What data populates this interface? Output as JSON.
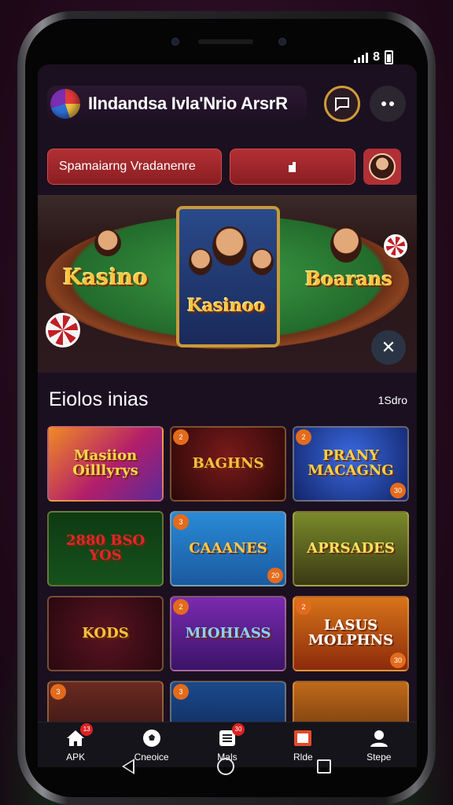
{
  "header": {
    "app_title": "Ilndandsa Ivla'Nrio ArsrR",
    "status_battery_label": "8"
  },
  "search": {
    "text": "Spamaiarng Vradanenre"
  },
  "banner": {
    "left_brand": "Kasino",
    "center_brand": "Kasinoo",
    "right_brand": "Boarans"
  },
  "section": {
    "title": "Eiolos inias",
    "link": "1Sdro"
  },
  "tiles": [
    {
      "title": "Masiion Oilllyrys",
      "bg": "linear-gradient(135deg,#f08a24,#b31e6a 55%,#5a2a9a)",
      "color": "#f8d64a",
      "badge": "",
      "badge_r": ""
    },
    {
      "title": "BAGHNS",
      "bg": "radial-gradient(circle at 50% 40%,#7a1a1a,#2a0808)",
      "color": "#f6c040",
      "badge": "2",
      "badge_r": ""
    },
    {
      "title": "PRANY MACAGNG",
      "bg": "radial-gradient(circle at 50% 40%,#3a6ae0,#12246a)",
      "color": "#f8d040",
      "badge": "2",
      "badge_r": "30"
    },
    {
      "title": "2880 BSO YOS",
      "bg": "linear-gradient(#0e3a12,#16521c)",
      "color": "#e0262a",
      "badge": "",
      "badge_r": ""
    },
    {
      "title": "CAAANES",
      "bg": "linear-gradient(#2a8ad6,#1a5aa0)",
      "color": "#f8c84a",
      "badge": "3",
      "badge_r": "20"
    },
    {
      "title": "APRSADES",
      "bg": "linear-gradient(#7a8a2a,#3a3a14)",
      "color": "#f8e060",
      "badge": "",
      "badge_r": ""
    },
    {
      "title": "KODS",
      "bg": "radial-gradient(circle at 50% 50%,#5a1420,#2a0810)",
      "color": "#f6c23a",
      "badge": "",
      "badge_r": ""
    },
    {
      "title": "MIOHIASS",
      "bg": "linear-gradient(#7a2ab0,#3a1468)",
      "color": "#8ad0ff",
      "badge": "2",
      "badge_r": ""
    },
    {
      "title": "LASUS MOLPHNS",
      "bg": "linear-gradient(#d8741a,#8a2a0a)",
      "color": "#ffffff",
      "badge": "2",
      "badge_r": "30"
    },
    {
      "title": "",
      "bg": "linear-gradient(#6a2a20,#2a1010)",
      "color": "#f8c84a",
      "badge": "3",
      "badge_r": ""
    },
    {
      "title": "",
      "bg": "linear-gradient(#1a4a8a,#0e2250)",
      "color": "#f8c84a",
      "badge": "3",
      "badge_r": ""
    },
    {
      "title": "",
      "bg": "linear-gradient(#c06a1a,#5a2a0a)",
      "color": "#f8c84a",
      "badge": "",
      "badge_r": ""
    }
  ],
  "bottom_nav": [
    {
      "label": "APK",
      "icon": "home-icon",
      "badge": "13"
    },
    {
      "label": "Cneoice",
      "icon": "soccer-ball-icon",
      "badge": ""
    },
    {
      "label": "Mals",
      "icon": "list-icon",
      "badge": "30"
    },
    {
      "label": "Rlde",
      "icon": "gift-icon",
      "badge": ""
    },
    {
      "label": "Stepe",
      "icon": "profile-icon",
      "badge": ""
    }
  ]
}
